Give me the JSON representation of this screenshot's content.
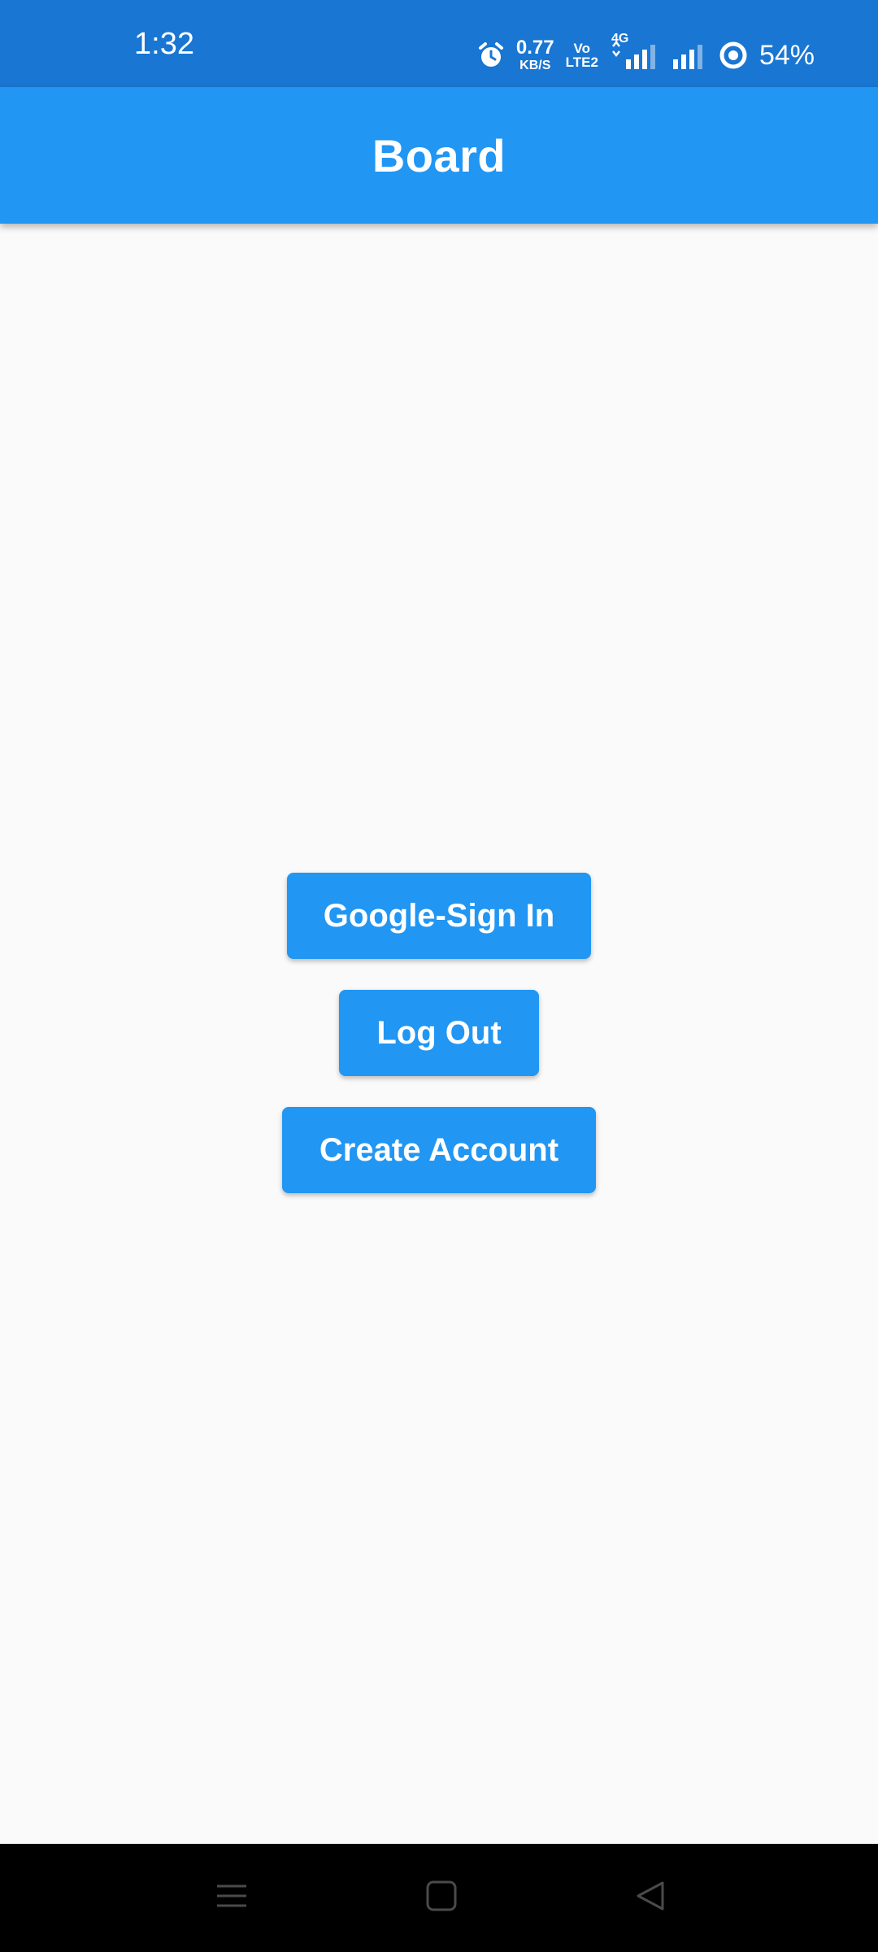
{
  "status_bar": {
    "time": "1:32",
    "net_speed_value": "0.77",
    "net_speed_unit": "KB/S",
    "volte_top": "Vo",
    "volte_bottom": "LTE2",
    "network_type": "4G",
    "battery_percent": "54%"
  },
  "app_bar": {
    "title": "Board"
  },
  "buttons": {
    "google_sign_in": "Google-Sign In",
    "log_out": "Log Out",
    "create_account": "Create Account"
  },
  "icons": {
    "alarm": "alarm-icon",
    "signal_1": "signal-strength-icon",
    "signal_2": "signal-strength-icon",
    "battery": "battery-ring-icon",
    "nav_menu": "menu-icon",
    "nav_home": "home-square-icon",
    "nav_back": "back-triangle-icon"
  },
  "colors": {
    "status_bar": "#1976d2",
    "app_bar": "#2196f3",
    "button": "#2196f3",
    "background": "#fafafa",
    "nav_bar": "#000000"
  }
}
